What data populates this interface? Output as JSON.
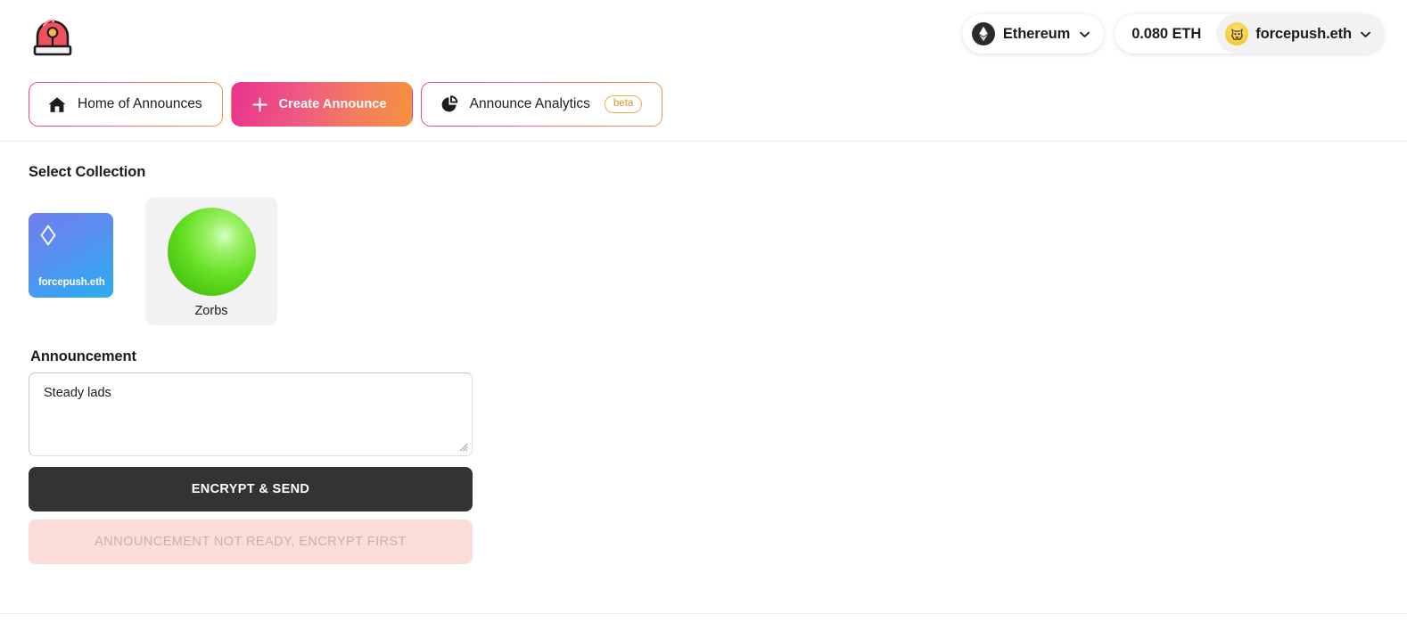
{
  "brand": {
    "logo_icon": "siren-icon"
  },
  "header": {
    "network": {
      "label": "Ethereum",
      "icon": "ethereum-icon",
      "chevron_icon": "chevron-down-icon"
    },
    "balance": "0.080 ETH",
    "account": {
      "label": "forcepush.eth",
      "avatar_icon": "metamask-fox-icon",
      "chevron_icon": "chevron-down-icon"
    }
  },
  "tabs": [
    {
      "label": "Home of Announces",
      "icon": "home-icon",
      "state": "outline"
    },
    {
      "label": "Create Announce",
      "icon": "plus-icon",
      "state": "active"
    },
    {
      "label": "Announce Analytics",
      "icon": "pie-chart-icon",
      "state": "outline",
      "badge": "beta"
    }
  ],
  "main": {
    "select_collection_title": "Select Collection",
    "collections": [
      {
        "name": "forcepush.eth",
        "kind": "ens",
        "icon": "ens-diamond-icon",
        "selected": false
      },
      {
        "name": "Zorbs",
        "kind": "zorb",
        "icon": "green-sphere-icon",
        "selected": true
      }
    ],
    "announcement": {
      "title": "Announcement",
      "value": "Steady lads",
      "placeholder": "",
      "encrypt_button": "ENCRYPT & SEND",
      "send_button": "ANNOUNCEMENT NOT READY, ENCRYPT FIRST"
    }
  },
  "colors": {
    "gradient_start": "#e9338f",
    "gradient_end": "#f4913f",
    "beta_badge": "#d99a2b",
    "primary_button": "#333335",
    "disabled_button_bg": "#fbdcd9",
    "disabled_button_text": "#c4b2b0",
    "zorb_green": "#66e024",
    "ens_blue": "#3fa0f0"
  }
}
